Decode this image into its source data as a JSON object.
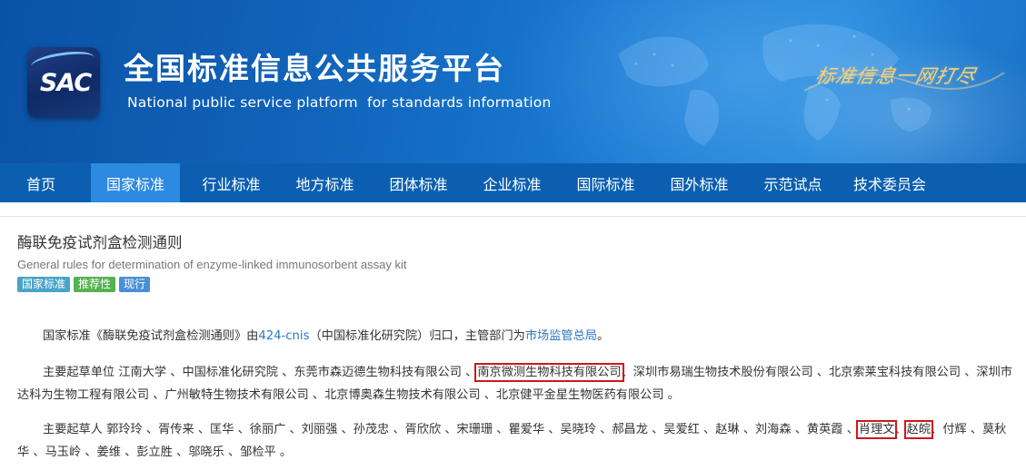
{
  "header": {
    "logo_text": "SAC",
    "title_cn": "全国标准信息公共服务平台",
    "title_en": "National public service platform  for standards information",
    "slogan": "标准信息一网打尽"
  },
  "nav": {
    "items": [
      {
        "label": "首页"
      },
      {
        "label": "国家标准"
      },
      {
        "label": "行业标准"
      },
      {
        "label": "地方标准"
      },
      {
        "label": "团体标准"
      },
      {
        "label": "企业标准"
      },
      {
        "label": "国际标准"
      },
      {
        "label": "国外标准"
      },
      {
        "label": "示范试点"
      },
      {
        "label": "技术委员会"
      }
    ],
    "active_index": 1
  },
  "standard": {
    "title_cn": "酶联免疫试剂盒检测通则",
    "title_en": "General rules for determination of enzyme-linked immunosorbent assay kit",
    "badges": [
      "国家标准",
      "推荐性",
      "现行"
    ]
  },
  "para1": {
    "prefix": "国家标准《酶联免疫试剂盒检测通则》由",
    "committee_link": "424-cnis",
    "middle": "（中国标准化研究院）归口，主管部门为",
    "authority_link": "市场监管总局",
    "suffix": "。"
  },
  "para2": {
    "prefix": "主要起草单位 江南大学 、中国标准化研究院 、东莞市森迈德生物科技有限公司 、",
    "boxed": "南京微测生物科技有限公司",
    "suffix": "、深圳市易瑞生物技术股份有限公司 、北京索莱宝科技有限公司 、深圳市达科为生物工程有限公司 、广州敏特生物技术有限公司 、北京博奥森生物技术有限公司 、北京健平金星生物医药有限公司 。"
  },
  "para3": {
    "prefix": "主要起草人 郭玲玲 、胥传来 、匡华 、徐丽广 、刘丽强 、孙茂忠 、胥欣欣 、宋珊珊 、瞿爱华 、吴晓玲 、郝昌龙 、吴爱红 、赵琳 、刘海森 、黄英霞 、",
    "boxed1": "肖理文",
    "between": "、",
    "boxed2": "赵皖",
    "suffix": "、付辉 、莫秋华 、马玉岭 、姜维 、彭立胜 、邬晓乐 、邹检平 。"
  },
  "colors": {
    "nav_bg": "#0c5fb0",
    "nav_active": "#2c8ae0",
    "link": "#2a76c4",
    "highlight_box": "#d0161b"
  }
}
